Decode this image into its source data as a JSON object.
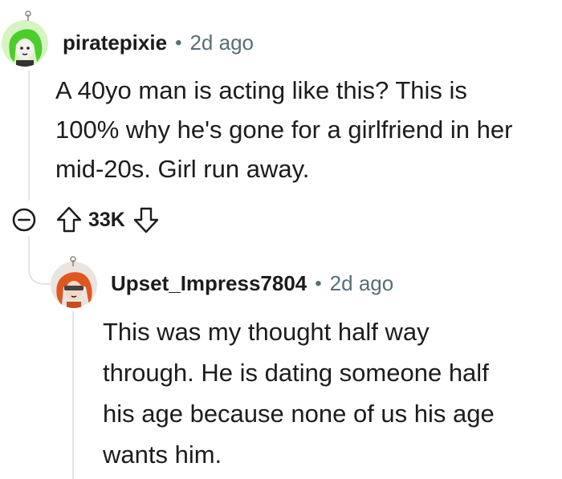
{
  "comment": {
    "username": "piratepixie",
    "separator": "•",
    "time": "2d ago",
    "lines": [
      "A 40yo man is acting like this? This is",
      "100% why he's gone for a girlfriend in her",
      "mid-20s. Girl run away."
    ],
    "score": "33K"
  },
  "reply": {
    "username": "Upset_Impress7804",
    "separator": "•",
    "time": "2d ago",
    "lines": [
      "This was my thought half way",
      "through. He is dating someone half",
      "his age because none of us his age",
      "wants him."
    ]
  },
  "icons": {
    "collapse": "collapse-minus-icon",
    "upvote": "upvote-arrow-icon",
    "downvote": "downvote-arrow-icon"
  },
  "colors": {
    "text": "#1c1c1c",
    "meta": "#576f76",
    "thread_line": "#e2e5e7",
    "avatar1_bg": "#d6f5c2",
    "avatar1_hair": "#4ccd2c",
    "avatar2_bg": "#e9e4e0",
    "avatar2_hair": "#e0561f"
  }
}
